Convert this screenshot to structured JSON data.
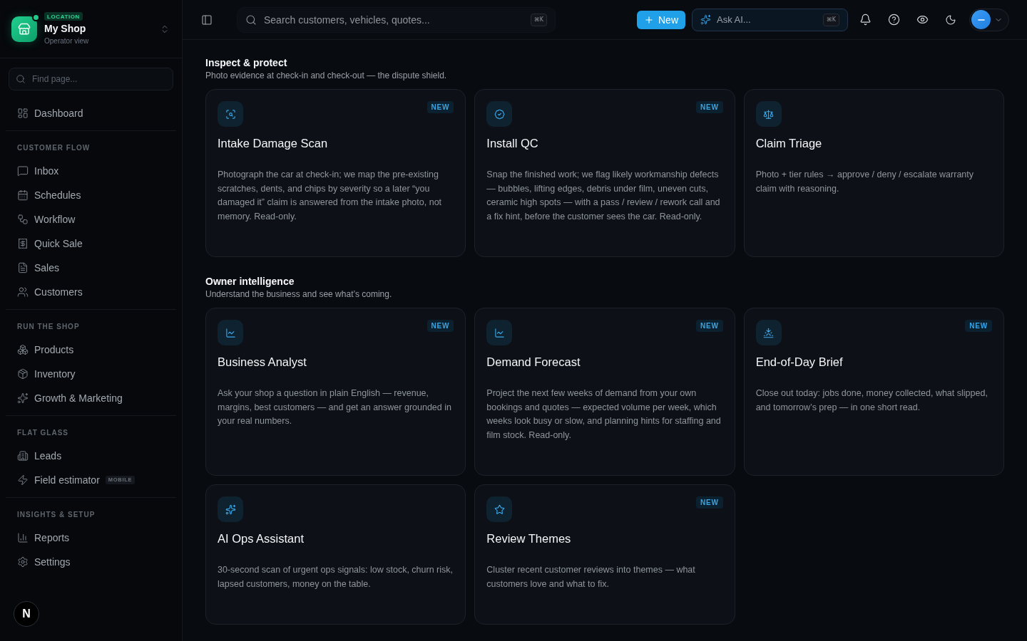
{
  "sidebar": {
    "location": {
      "tag": "LOCATION",
      "name": "My Shop",
      "subtitle": "Operator view"
    },
    "search": {
      "placeholder": "Find page..."
    },
    "groups": [
      {
        "items": [
          {
            "label": "Dashboard",
            "selected": false
          }
        ]
      },
      {
        "title": "CUSTOMER FLOW",
        "items": [
          {
            "label": "Inbox",
            "selected": false
          },
          {
            "label": "Schedules",
            "selected": false
          },
          {
            "label": "Workflow",
            "selected": false
          },
          {
            "label": "Quick Sale",
            "selected": false
          },
          {
            "label": "Sales",
            "selected": false
          },
          {
            "label": "Customers",
            "selected": false
          }
        ]
      },
      {
        "title": "RUN THE SHOP",
        "items": [
          {
            "label": "Products",
            "selected": false
          },
          {
            "label": "Inventory",
            "selected": false
          },
          {
            "label": "Growth & Marketing",
            "selected": false
          }
        ]
      },
      {
        "title": "FLAT GLASS",
        "items": [
          {
            "label": "Leads",
            "selected": false
          },
          {
            "label": "Field estimator",
            "badge": "MOBILE",
            "selected": false
          }
        ]
      },
      {
        "title": "INSIGHTS & SETUP",
        "items": [
          {
            "label": "Reports",
            "selected": false
          },
          {
            "label": "Settings",
            "selected": false
          }
        ]
      }
    ],
    "footer_button": "N"
  },
  "topbar": {
    "search": {
      "placeholder": "Search customers, vehicles, quotes...",
      "shortcut": "⌘K"
    },
    "new_button": "New",
    "ask_ai": {
      "label": "Ask AI...",
      "shortcut": "⌘K"
    }
  },
  "sections": [
    {
      "title": "Inspect & protect",
      "subtitle": "Photo evidence at check-in and check-out — the dispute shield.",
      "cards": [
        {
          "title": "Intake Damage Scan",
          "badge": "NEW",
          "description": "Photograph the car at check-in; we map the pre-existing scratches, dents, and chips by severity so a later “you damaged it” claim is answered from the intake photo, not memory. Read-only."
        },
        {
          "title": "Install QC",
          "badge": "NEW",
          "description": "Snap the finished work; we flag likely workmanship defects — bubbles, lifting edges, debris under film, uneven cuts, ceramic high spots — with a pass / review / rework call and a fix hint, before the customer sees the car. Read-only."
        },
        {
          "title": "Claim Triage",
          "description": "Photo + tier rules → approve / deny / escalate warranty claim with reasoning."
        }
      ]
    },
    {
      "title": "Owner intelligence",
      "subtitle": "Understand the business and see what’s coming.",
      "cards": [
        {
          "title": "Business Analyst",
          "badge": "NEW",
          "description": "Ask your shop a question in plain English — revenue, margins, best customers — and get an answer grounded in your real numbers."
        },
        {
          "title": "Demand Forecast",
          "badge": "NEW",
          "description": "Project the next few weeks of demand from your own bookings and quotes — expected volume per week, which weeks look busy or slow, and planning hints for staffing and film stock. Read-only."
        },
        {
          "title": "End-of-Day Brief",
          "badge": "NEW",
          "description": "Close out today: jobs done, money collected, what slipped, and tomorrow’s prep — in one short read."
        },
        {
          "title": "AI Ops Assistant",
          "description": "30-second scan of urgent ops signals: low stock, churn risk, lapsed customers, money on the table."
        },
        {
          "title": "Review Themes",
          "badge": "NEW",
          "description": "Cluster recent customer reviews into themes — what customers love and what to fix."
        }
      ]
    }
  ]
}
